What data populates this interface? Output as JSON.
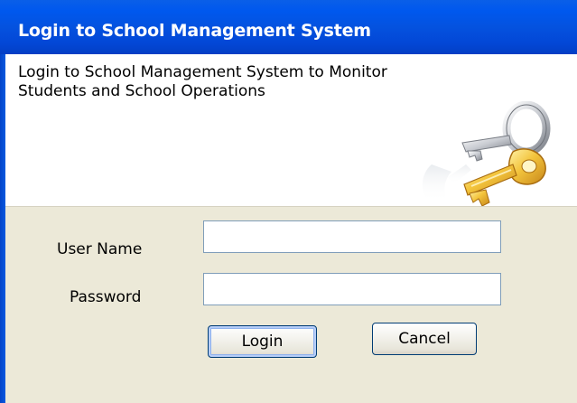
{
  "window": {
    "title": "Login to School Management System"
  },
  "banner": {
    "description_line1": "Login to School Management System to Monitor",
    "description_line2": "Students and School Operations",
    "icon": "keys-icon"
  },
  "form": {
    "username_label": "User Name",
    "username_value": "",
    "password_label": "Password",
    "password_value": ""
  },
  "buttons": {
    "login_label": "Login",
    "cancel_label": "Cancel"
  },
  "colors": {
    "titlebar": "#0452df",
    "form_background": "#ece9d8",
    "textbox_border": "#7f9db9",
    "button_border": "#003c74"
  }
}
